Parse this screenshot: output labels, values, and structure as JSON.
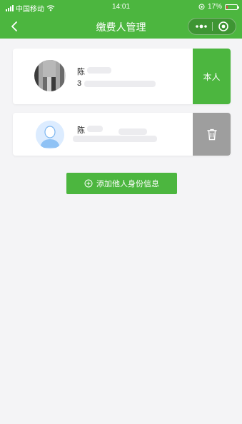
{
  "status_bar": {
    "carrier": "中国移动",
    "time": "14:01",
    "battery": "17%",
    "battery_level": 0.17
  },
  "nav": {
    "title": "缴费人管理",
    "icons": {
      "back": "chevron-left-icon",
      "more": "more-dots-icon",
      "close": "target-icon"
    }
  },
  "payers": [
    {
      "name": "陈",
      "id_partial": "3",
      "action_label": "本人",
      "avatar": "photo"
    },
    {
      "name": "陈",
      "id_partial": "",
      "action": "trash-icon",
      "avatar": "default-person-icon"
    }
  ],
  "add_button": {
    "label": "添加他人身份信息",
    "icon": "plus-circle-icon"
  },
  "colors": {
    "brand_green": "#4cb63f",
    "delete_gray": "#9e9e9e",
    "background": "#f4f4f6"
  }
}
